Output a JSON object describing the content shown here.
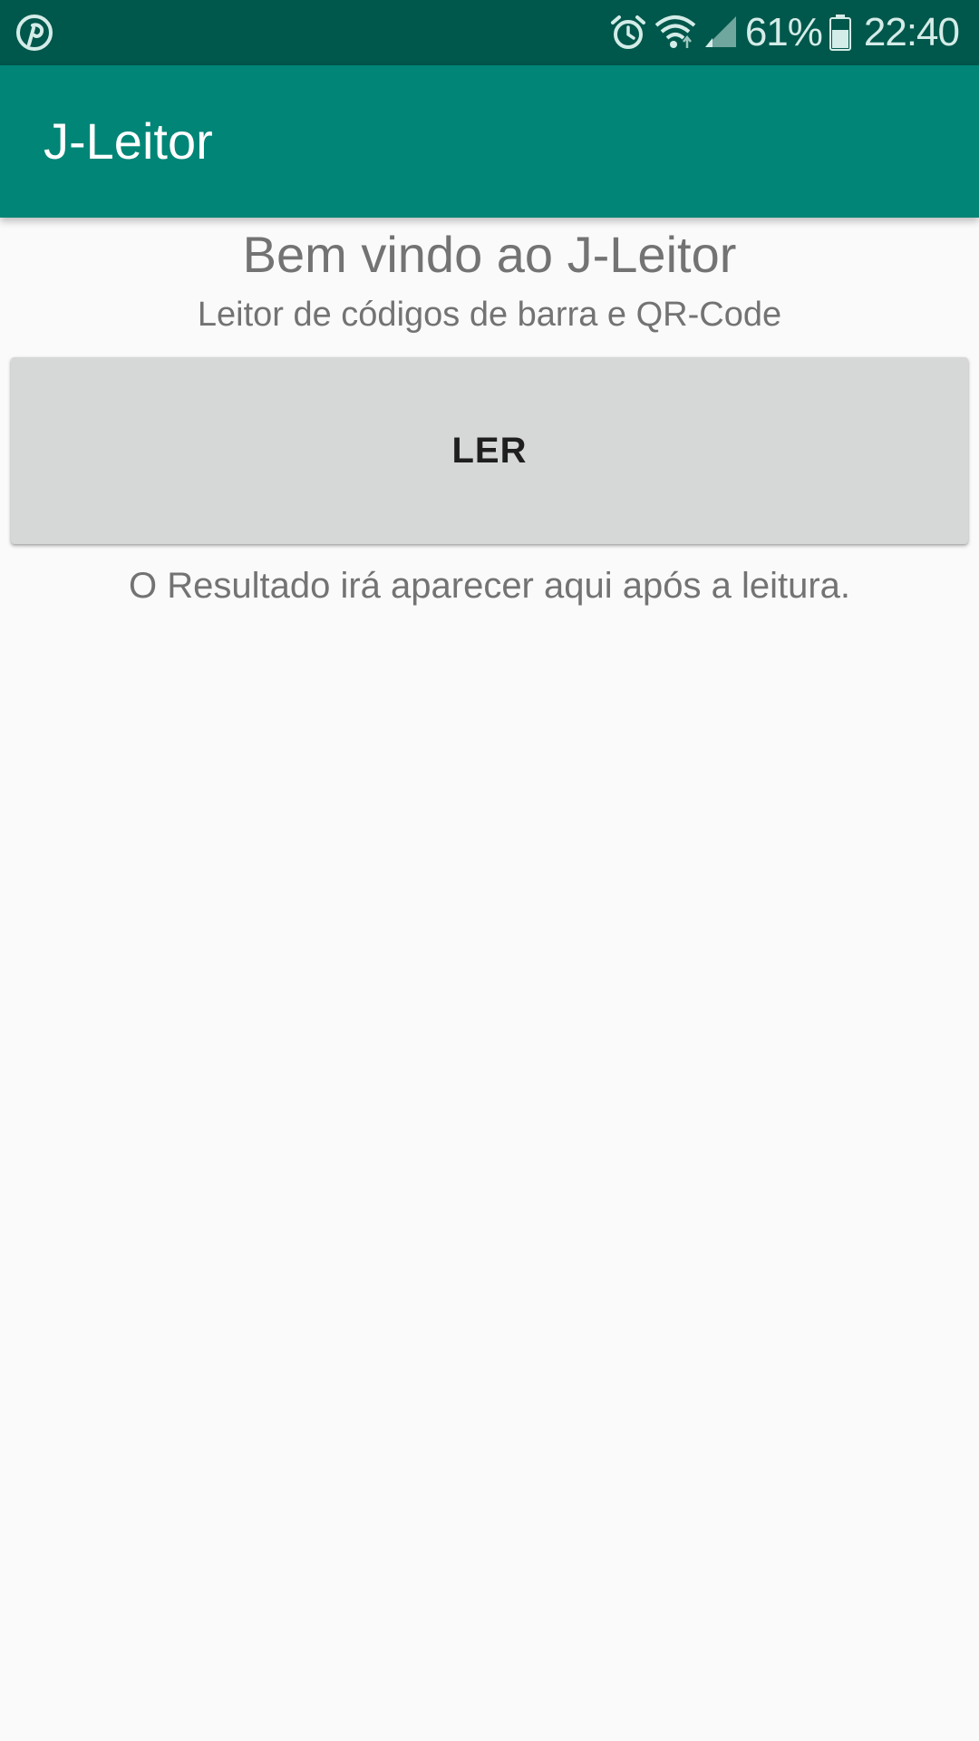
{
  "status_bar": {
    "left_icon": "pinterest-icon",
    "icons": [
      "alarm-icon",
      "wifi-icon",
      "signal-icon",
      "battery-icon"
    ],
    "battery_percent": "61%",
    "time": "22:40"
  },
  "app_bar": {
    "title": "J-Leitor",
    "color": "#008577"
  },
  "main": {
    "welcome_title": "Bem vindo ao J-Leitor",
    "welcome_subtitle": "Leitor de códigos de barra e QR-Code",
    "read_button_label": "LER",
    "result_text": "O Resultado irá aparecer aqui após a leitura."
  },
  "colors": {
    "status_bar": "#00574b",
    "app_bar": "#008577",
    "background": "#fafafa",
    "button": "#d6d7d7"
  }
}
